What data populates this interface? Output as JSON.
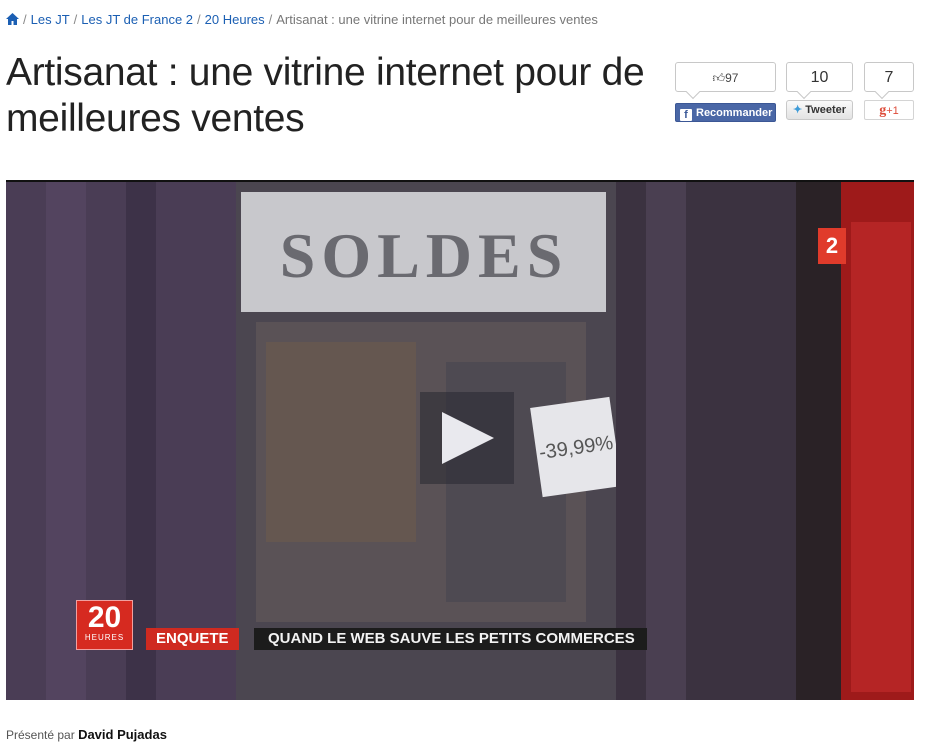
{
  "breadcrumb": {
    "items": [
      "Les JT",
      "Les JT de France 2",
      "20 Heures"
    ],
    "current": "Artisanat : une vitrine internet pour de meilleures ventes",
    "separator": "/"
  },
  "title": "Artisanat : une vitrine internet pour de meilleures ventes",
  "share": {
    "facebook": {
      "count": "97",
      "label": "Recommander"
    },
    "twitter": {
      "count": "10",
      "label": "Tweeter"
    },
    "gplus": {
      "count": "7",
      "label": "+1"
    }
  },
  "video": {
    "shop_sign": "SOLDES",
    "discount_tag": "-39,99%",
    "channel_logo": "2",
    "show_logo_number": "20",
    "show_logo_sub": "HEURES",
    "tag": "ENQUETE",
    "headline": "QUAND LE WEB SAUVE LES PETITS COMMERCES"
  },
  "presenter": {
    "prefix": "Présenté par",
    "name": "David Pujadas"
  },
  "colors": {
    "link": "#1b5fb3",
    "facebook": "#4a67a6",
    "france2_red": "#d62a20"
  }
}
